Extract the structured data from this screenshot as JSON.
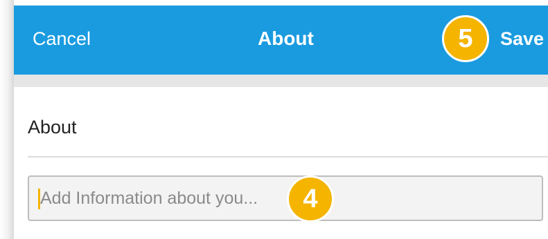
{
  "header": {
    "cancel_label": "Cancel",
    "title": "About",
    "save_label": "Save",
    "background_color": "#1a9be0"
  },
  "section": {
    "label": "About"
  },
  "about_field": {
    "value": "",
    "placeholder": "Add Information about you..."
  },
  "callouts": {
    "save_step": "5",
    "input_step": "4",
    "color": "#f4b400"
  }
}
